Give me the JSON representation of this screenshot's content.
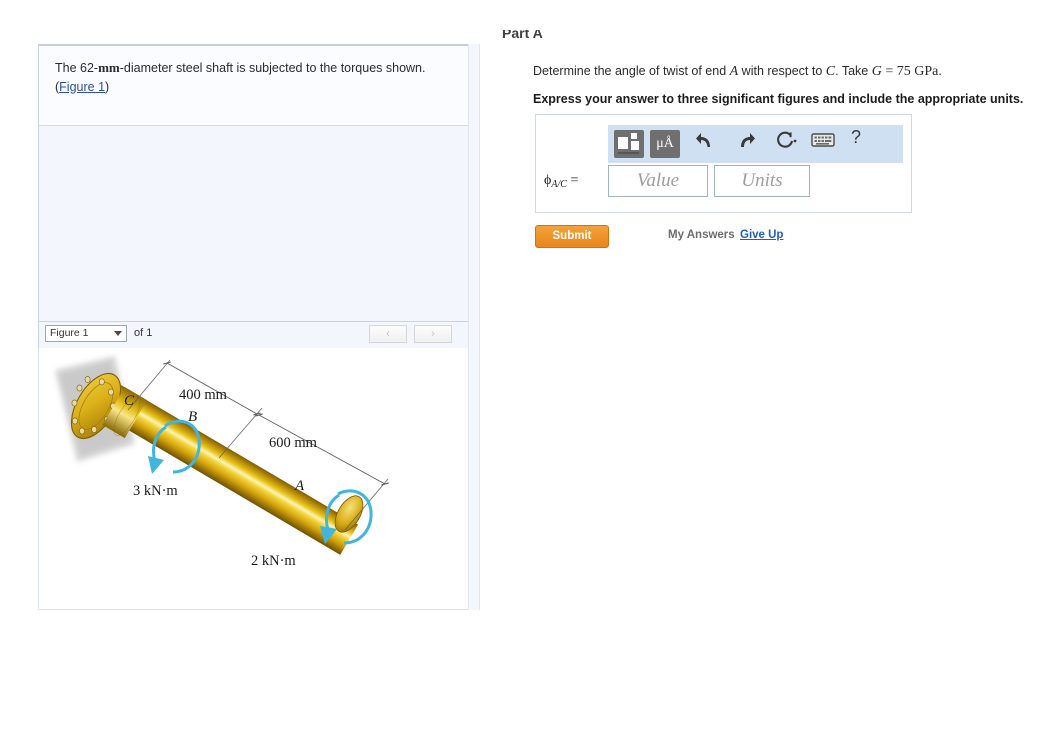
{
  "problem": {
    "text_before": "The 62-",
    "unit_bold": "mm",
    "text_after": "-diameter steel shaft is subjected to the torques shown.",
    "figure_link": "Figure 1",
    "paren_open": "(",
    "paren_close": ")"
  },
  "figure_nav": {
    "selected": "Figure 1",
    "of_label": "of 1",
    "prev_icon": "chevron-left-icon",
    "next_icon": "chevron-right-icon",
    "prev_glyph": "‹",
    "next_glyph": "›"
  },
  "figure": {
    "labels": {
      "point_c": "C",
      "point_b": "B",
      "point_a": "A",
      "dim_400": "400 mm",
      "dim_600": "600 mm",
      "torque_b": "3 kN·m",
      "torque_a": "2 kN·m"
    },
    "colors": {
      "shaft_dark": "#8a6a06",
      "shaft_mid": "#d8a90c",
      "shaft_bright": "#f0d23a",
      "shaft_highlight": "#fdf6c8",
      "flange": "#d9ad17",
      "wall": "#cfcfcf",
      "torque_arrow": "#3fb5e0",
      "dimension_line": "#6b6b6b"
    }
  },
  "part": {
    "header": "Part A",
    "question_prefix": "Determine the angle of twist of end ",
    "question_var_a": "A",
    "question_mid": " with respect to ",
    "question_var_c": "C",
    "question_take": ". Take ",
    "question_var_g": "G",
    "question_eq": " = 75 GPa",
    "question_period": ".",
    "instruction": "Express your answer to three significant figures and include the appropriate units."
  },
  "answer": {
    "symbol_phi": "ϕ",
    "symbol_sub": "A/C",
    "symbol_eq": " =",
    "value_placeholder": "Value",
    "units_placeholder": "Units",
    "value": "",
    "units": ""
  },
  "toolbar": {
    "template_icon": "math-template-icon",
    "units_icon": "micro-angstrom-icon",
    "units_label": "μÅ",
    "undo_icon": "undo-arrow-icon",
    "redo_icon": "redo-arrow-icon",
    "reset_icon": "reset-circle-icon",
    "keyboard_icon": "keyboard-icon",
    "help_icon": "help-question-icon",
    "help_label": "?"
  },
  "actions": {
    "submit_label": "Submit",
    "my_answers_label": "My Answers",
    "give_up_label": "Give Up"
  }
}
